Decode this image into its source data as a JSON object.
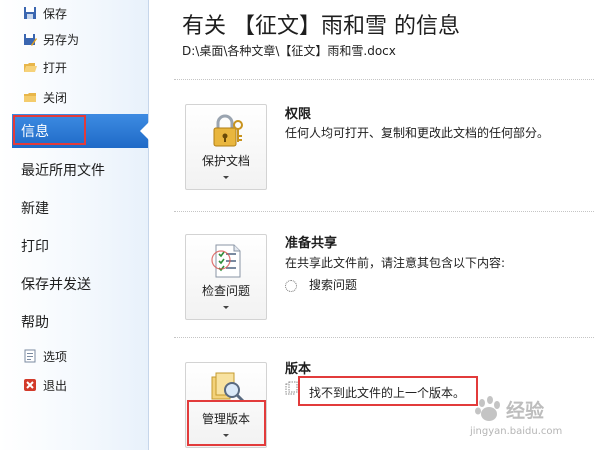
{
  "sidebar": {
    "top_items": [
      {
        "label": "保存",
        "icon": "save-icon"
      },
      {
        "label": "另存为",
        "icon": "save-as-icon"
      },
      {
        "label": "打开",
        "icon": "open-folder-icon"
      },
      {
        "label": "关闭",
        "icon": "close-folder-icon"
      }
    ],
    "active_label": "信息",
    "main_items": [
      "最近所用文件",
      "新建",
      "打印",
      "保存并发送",
      "帮助"
    ],
    "bottom_items": [
      {
        "label": "选项",
        "icon": "options-icon"
      },
      {
        "label": "退出",
        "icon": "exit-icon"
      }
    ]
  },
  "main": {
    "title": "有关 【征文】雨和雪 的信息",
    "path": "D:\\桌面\\各种文章\\【征文】雨和雪.docx",
    "sections": [
      {
        "button_label": "保护文档",
        "button_icon": "lock-key-icon",
        "title": "权限",
        "description": "任何人均可打开、复制和更改此文档的任何部分。"
      },
      {
        "button_label": "检查问题",
        "button_icon": "checklist-icon",
        "title": "准备共享",
        "description": "在共享此文件前，请注意其包含以下内容:",
        "sub_item": "搜索问题"
      },
      {
        "button_label": "管理版本",
        "button_icon": "versions-magnifier-icon",
        "title": "版本",
        "description": "找不到此文件的上一个版本。"
      }
    ]
  },
  "watermark": {
    "text": "经验",
    "url": "jingyan.baidu.com"
  },
  "colors": {
    "active_bg": "#2b78d6",
    "highlight_red": "#e23b3b",
    "sidebar_bg": "#eef5fc"
  }
}
